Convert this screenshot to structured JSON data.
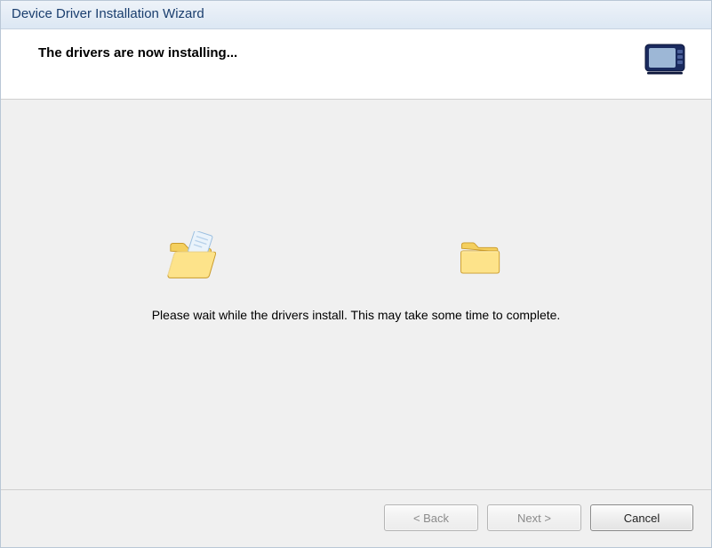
{
  "window": {
    "title": "Device Driver Installation Wizard"
  },
  "header": {
    "heading": "The drivers are now installing..."
  },
  "content": {
    "message": "Please wait while the drivers install. This may take some time to complete."
  },
  "footer": {
    "back_label": "< Back",
    "next_label": "Next >",
    "cancel_label": "Cancel"
  },
  "icons": {
    "device": "device-icon",
    "folder_source": "open-folder-with-file-icon",
    "folder_dest": "closed-folder-icon"
  }
}
